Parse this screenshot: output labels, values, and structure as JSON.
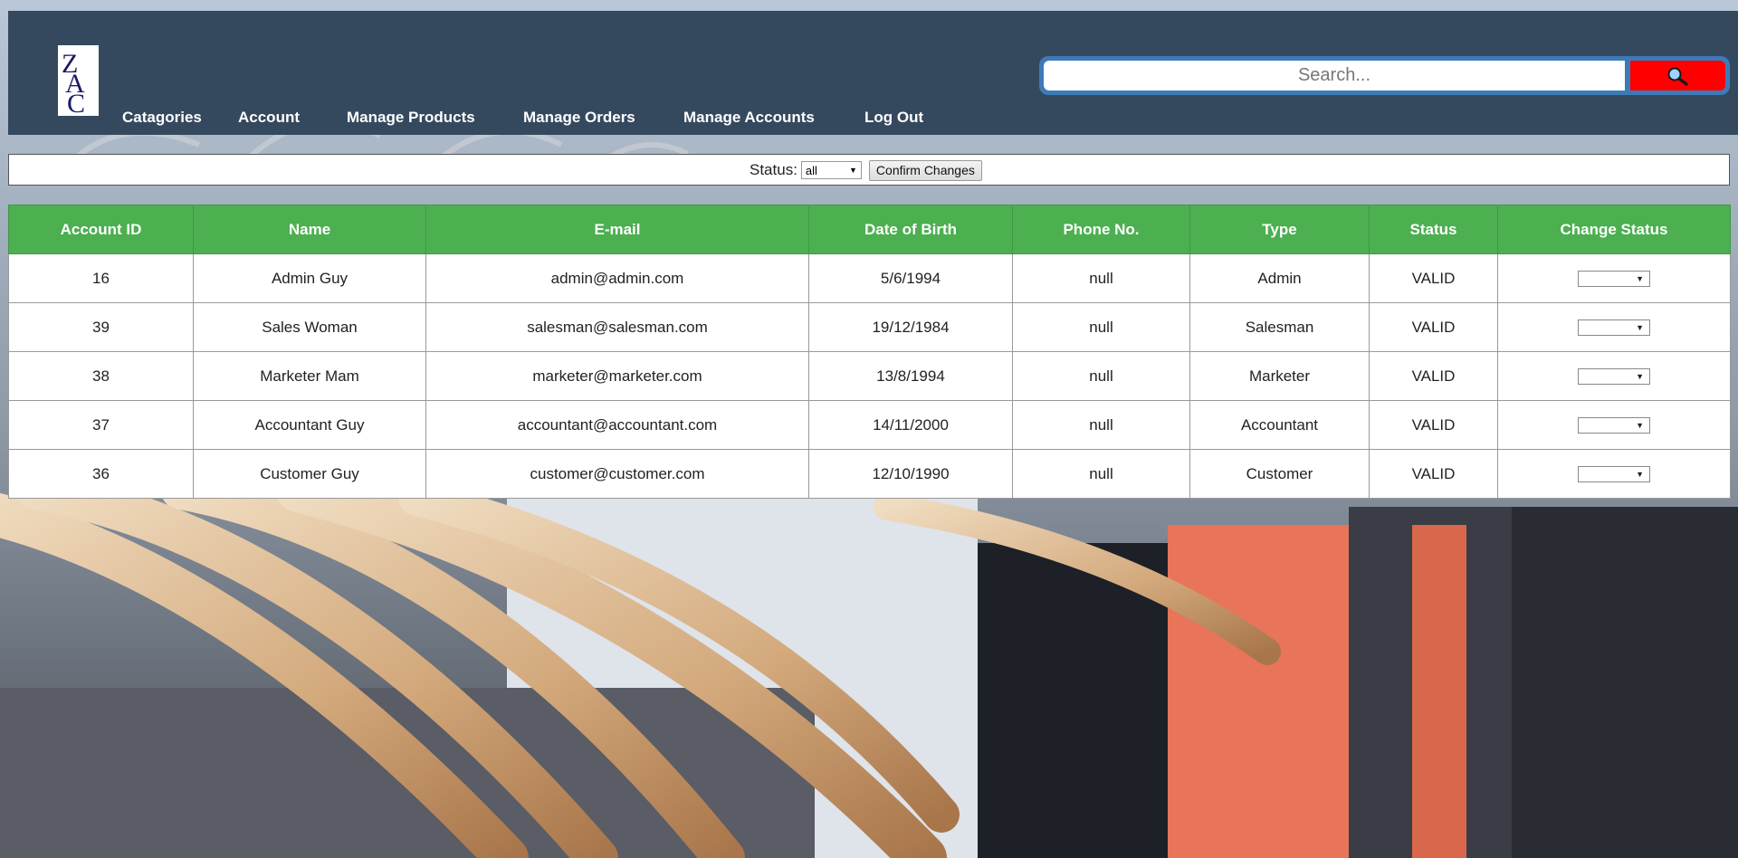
{
  "header": {
    "logo_text": "ZAC",
    "nav": [
      {
        "label": "Catagories"
      },
      {
        "label": "Account"
      },
      {
        "label": "Manage Products"
      },
      {
        "label": "Manage Orders"
      },
      {
        "label": "Manage Accounts"
      },
      {
        "label": "Log Out"
      }
    ],
    "search": {
      "placeholder": "Search...",
      "button_icon": "search-icon"
    }
  },
  "filter": {
    "label": "Status:",
    "selected": "all",
    "confirm_label": "Confirm Changes"
  },
  "table": {
    "columns": [
      "Account ID",
      "Name",
      "E-mail",
      "Date of Birth",
      "Phone No.",
      "Type",
      "Status",
      "Change Status"
    ],
    "rows": [
      {
        "id": "16",
        "name": "Admin Guy",
        "email": "admin@admin.com",
        "dob": "5/6/1994",
        "phone": "null",
        "type": "Admin",
        "status": "VALID",
        "change": ""
      },
      {
        "id": "39",
        "name": "Sales Woman",
        "email": "salesman@salesman.com",
        "dob": "19/12/1984",
        "phone": "null",
        "type": "Salesman",
        "status": "VALID",
        "change": ""
      },
      {
        "id": "38",
        "name": "Marketer Mam",
        "email": "marketer@marketer.com",
        "dob": "13/8/1994",
        "phone": "null",
        "type": "Marketer",
        "status": "VALID",
        "change": ""
      },
      {
        "id": "37",
        "name": "Accountant Guy",
        "email": "accountant@accountant.com",
        "dob": "14/11/2000",
        "phone": "null",
        "type": "Accountant",
        "status": "VALID",
        "change": ""
      },
      {
        "id": "36",
        "name": "Customer Guy",
        "email": "customer@customer.com",
        "dob": "12/10/1990",
        "phone": "null",
        "type": "Customer",
        "status": "VALID",
        "change": ""
      }
    ]
  },
  "colors": {
    "header_bg": "#34495e",
    "table_header_bg": "#4caf50",
    "search_border": "#3d7ab8",
    "search_button": "#ff0000"
  }
}
